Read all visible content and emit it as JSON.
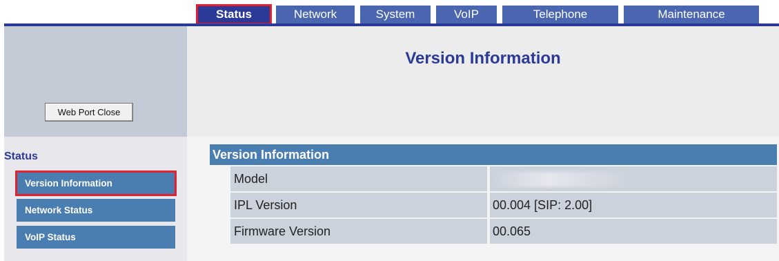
{
  "nav": {
    "tabs": [
      {
        "label": "Status",
        "active": true
      },
      {
        "label": "Network",
        "active": false
      },
      {
        "label": "System",
        "active": false
      },
      {
        "label": "VoIP",
        "active": false
      },
      {
        "label": "Telephone",
        "active": false
      },
      {
        "label": "Maintenance",
        "active": false
      }
    ]
  },
  "sidebar": {
    "web_port_button": "Web Port Close",
    "section_heading": "Status",
    "items": [
      {
        "label": "Version Information",
        "active": true
      },
      {
        "label": "Network Status",
        "active": false
      },
      {
        "label": "VoIP Status",
        "active": false
      }
    ]
  },
  "main": {
    "page_title": "Version Information",
    "table": {
      "header": "Version Information",
      "rows": [
        {
          "label": "Model",
          "value": ""
        },
        {
          "label": "IPL Version",
          "value": "00.004  [SIP: 2.00]"
        },
        {
          "label": "Firmware Version",
          "value": "00.065"
        }
      ]
    }
  },
  "colors": {
    "tab_bg": "#4a66b0",
    "tab_active_bg": "#2a3a96",
    "highlight_outline": "#e4202e",
    "header_blue": "#4a7db0",
    "row_bg": "#ccd2dc",
    "title_color": "#2a3a96"
  }
}
